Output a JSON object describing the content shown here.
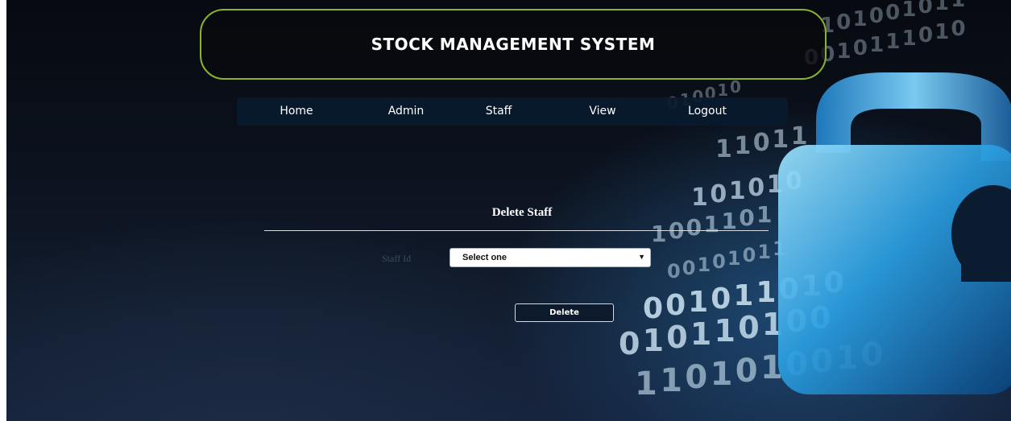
{
  "header": {
    "title": "STOCK MANAGEMENT SYSTEM"
  },
  "nav": {
    "items": [
      {
        "label": "Home"
      },
      {
        "label": "Admin"
      },
      {
        "label": "Staff"
      },
      {
        "label": "View"
      },
      {
        "label": "Logout"
      }
    ]
  },
  "form": {
    "title": "Delete Staff",
    "staff_id_label": "Staff Id",
    "staff_select": {
      "value": "Select one"
    },
    "delete_label": "Delete"
  },
  "background": {
    "binary_digits": [
      "1",
      "0",
      "1",
      "0",
      "0",
      "1",
      "0",
      "1",
      "1",
      "0",
      "0",
      "1",
      "0",
      "1",
      "1",
      "1",
      "0",
      "1",
      "0",
      "0",
      "1",
      "0",
      "0",
      "1",
      "0",
      "1",
      "1",
      "0",
      "1",
      "1",
      "1",
      "0",
      "1",
      "0",
      "1",
      "0",
      "1",
      "0",
      "0",
      "1",
      "1",
      "0",
      "1",
      "0",
      "0",
      "1",
      "0",
      "1",
      "0",
      "1",
      "1",
      "0",
      "0",
      "1",
      "0",
      "1",
      "1",
      "0",
      "1",
      "0",
      "0",
      "1",
      "0",
      "1",
      "1",
      "0",
      "1",
      "0",
      "0",
      "1",
      "1",
      "0"
    ],
    "colors": {
      "accent_green": "#8cb32a",
      "lock_blue": "#3fb4ee",
      "nav_bg": "#081a2c"
    }
  }
}
